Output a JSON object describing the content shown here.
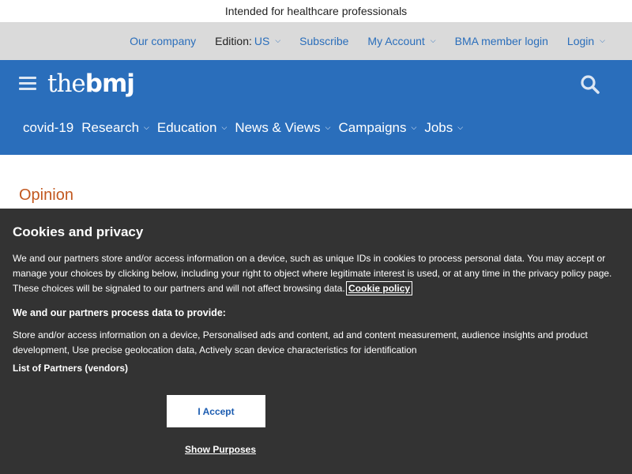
{
  "topbar": {
    "text": "Intended for healthcare professionals"
  },
  "utility": {
    "our_company": "Our company",
    "edition_label": "Edition:",
    "edition_value": "US",
    "subscribe": "Subscribe",
    "my_account": "My Account",
    "bma_login": "BMA member login",
    "login": "Login"
  },
  "header": {
    "logo_the": "the",
    "logo_bmj": "bmj",
    "nav": [
      "covid-19",
      "Research",
      "Education",
      "News & Views",
      "Campaigns",
      "Jobs"
    ],
    "bg_color": "#2a6ebb"
  },
  "content": {
    "section_title": "Opinion"
  },
  "cookie": {
    "title": "Cookies and privacy",
    "body": "We and our partners store and/or access information on a device, such as unique IDs in cookies to process personal data. You may accept or manage your choices by clicking below, including your right to object where legitimate interest is used, or at any time in the privacy policy page. These choices will be signaled to our partners and will not affect browsing data.",
    "policy_link": "Cookie policy",
    "subheading": "We and our partners process data to provide:",
    "purposes": "Store and/or access information on a device, Personalised ads and content, ad and content measurement, audience insights and product development, Use precise geolocation data, Actively scan device characteristics for identification",
    "partners_link": "List of Partners (vendors)",
    "accept": "I Accept",
    "show_purposes": "Show Purposes"
  }
}
